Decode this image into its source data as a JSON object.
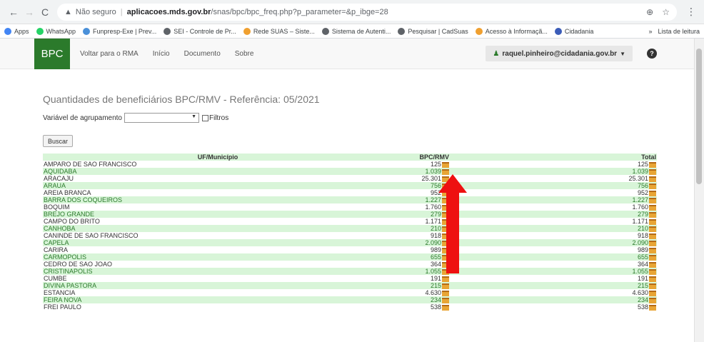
{
  "browser": {
    "nav_back": "←",
    "nav_forward": "→",
    "nav_reload": "C",
    "security_label": "Não seguro",
    "url_domain": "aplicacoes.mds.gov.br",
    "url_path": "/snas/bpc/bpc_freq.php?p_parameter=&p_ibge=28",
    "zoom_icon": "⊕",
    "star_icon": "☆",
    "menu_icon": "⋮"
  },
  "bookmarks": {
    "items": [
      {
        "label": "Apps",
        "color": "#4285f4"
      },
      {
        "label": "WhatsApp",
        "color": "#25d366"
      },
      {
        "label": "Funpresp-Exe | Prev...",
        "color": "#4a90d9"
      },
      {
        "label": "SEI - Controle de Pr...",
        "color": "#5f6368"
      },
      {
        "label": "Rede SUAS – Siste...",
        "color": "#f0a030"
      },
      {
        "label": "Sistema de Autenti...",
        "color": "#5f6368"
      },
      {
        "label": "Pesquisar | CadSuas",
        "color": "#5f6368"
      },
      {
        "label": "Acesso à Informaçã...",
        "color": "#f0a030"
      },
      {
        "label": "Cidadania",
        "color": "#3b5cb8"
      }
    ],
    "more": "»",
    "reading_list": "Lista de leitura"
  },
  "navbar": {
    "brand": "BPC",
    "links": [
      "Voltar para o RMA",
      "Início",
      "Documento",
      "Sobre"
    ],
    "user_email": "raquel.pinheiro@cidadania.gov.br",
    "help": "?"
  },
  "page": {
    "title": "Quantidades de beneficiários BPC/RMV - Referência: 05/2021",
    "group_label": "Variável de agrupamento",
    "filters_label": "Filtros",
    "search_button": "Buscar"
  },
  "table": {
    "headers": [
      "UF/Município",
      "BPC/RMV",
      "Total"
    ],
    "rows": [
      [
        "AMPARO DE SAO FRANCISCO",
        "125",
        "125"
      ],
      [
        "AQUIDABA",
        "1.039",
        "1.039"
      ],
      [
        "ARACAJU",
        "25.301",
        "25.301"
      ],
      [
        "ARAUA",
        "756",
        "756"
      ],
      [
        "AREIA BRANCA",
        "952",
        "952"
      ],
      [
        "BARRA DOS COQUEIROS",
        "1.227",
        "1.227"
      ],
      [
        "BOQUIM",
        "1.760",
        "1.760"
      ],
      [
        "BREJO GRANDE",
        "279",
        "279"
      ],
      [
        "CAMPO DO BRITO",
        "1.171",
        "1.171"
      ],
      [
        "CANHOBA",
        "210",
        "210"
      ],
      [
        "CANINDE DE SAO FRANCISCO",
        "918",
        "918"
      ],
      [
        "CAPELA",
        "2.090",
        "2.090"
      ],
      [
        "CARIRA",
        "989",
        "989"
      ],
      [
        "CARMOPOLIS",
        "655",
        "655"
      ],
      [
        "CEDRO DE SAO JOAO",
        "364",
        "364"
      ],
      [
        "CRISTINAPOLIS",
        "1.055",
        "1.055"
      ],
      [
        "CUMBE",
        "191",
        "191"
      ],
      [
        "DIVINA PASTORA",
        "215",
        "215"
      ],
      [
        "ESTANCIA",
        "4.630",
        "4.630"
      ],
      [
        "FEIRA NOVA",
        "234",
        "234"
      ],
      [
        "FREI PAULO",
        "538",
        "538"
      ]
    ]
  },
  "colors": {
    "brand_green": "#2b7a2b",
    "row_stripe": "#d8f5d8",
    "arrow_red": "#ee1111"
  }
}
